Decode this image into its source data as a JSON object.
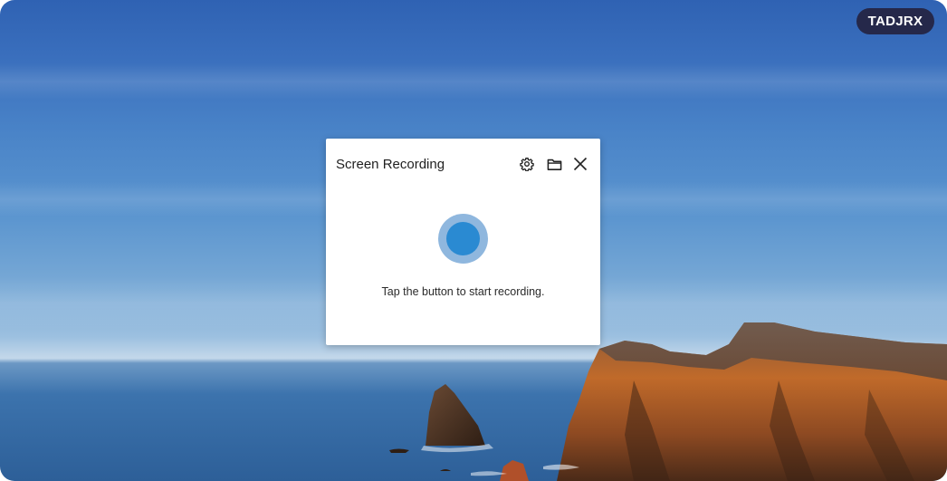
{
  "badge": {
    "label": "TADJRX"
  },
  "dialog": {
    "title": "Screen Recording",
    "hint": "Tap the button to start recording.",
    "icons": {
      "settings": "gear-icon",
      "folder": "folder-icon",
      "close": "close-icon"
    }
  },
  "colors": {
    "badge_bg": "#25284a",
    "record_outer": "#8fb7de",
    "record_inner": "#2a8ad2"
  }
}
